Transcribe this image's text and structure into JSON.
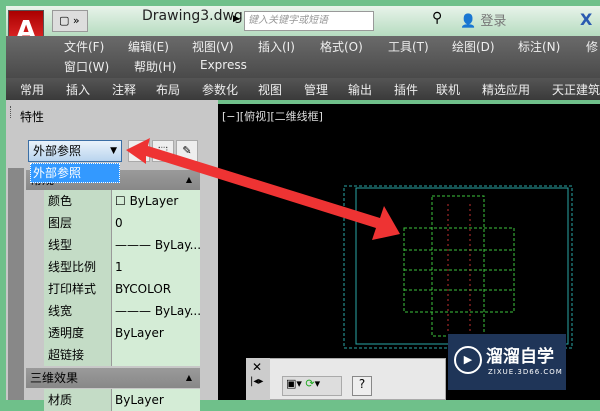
{
  "title": {
    "doc": "Drawing3.dwg",
    "search_placeholder": "键入关键字或短语",
    "login": "登录",
    "logo": "A",
    "qat": "▢ »",
    "x": "X"
  },
  "menus": [
    "文件(F)",
    "编辑(E)",
    "视图(V)",
    "插入(I)",
    "格式(O)",
    "工具(T)",
    "绘图(D)",
    "标注(N)",
    "修",
    "窗口(W)",
    "帮助(H)",
    "Express"
  ],
  "tabs": [
    "常用",
    "插入",
    "注释",
    "布局",
    "参数化",
    "视图",
    "管理",
    "输出",
    "插件",
    "联机",
    "精选应用",
    "天正建筑"
  ],
  "panel": {
    "title": "特性",
    "combo": "外部参照",
    "dropdown_item": "外部参照",
    "section1": "常规",
    "rows": [
      {
        "l": "颜色",
        "v": "☐ ByLayer"
      },
      {
        "l": "图层",
        "v": "0"
      },
      {
        "l": "线型",
        "v": "——— ByLay..."
      },
      {
        "l": "线型比例",
        "v": "1"
      },
      {
        "l": "打印样式",
        "v": "BYCOLOR"
      },
      {
        "l": "线宽",
        "v": "——— ByLay..."
      },
      {
        "l": "透明度",
        "v": "ByLayer"
      },
      {
        "l": "超链接",
        "v": ""
      }
    ],
    "section2": "三维效果",
    "rows2": [
      {
        "l": "材质",
        "v": "ByLayer"
      }
    ]
  },
  "viewport": {
    "label": "[−][俯视][二维线框]"
  },
  "command": {
    "close": "✕",
    "help": "?"
  },
  "watermark": {
    "title": "溜溜自学",
    "site": "ZIXUE.3D66.COM"
  },
  "colors": {
    "arrow": "#ee3333",
    "drawing_green": "#3ec43e",
    "drawing_cyan": "#2aa6a6"
  }
}
